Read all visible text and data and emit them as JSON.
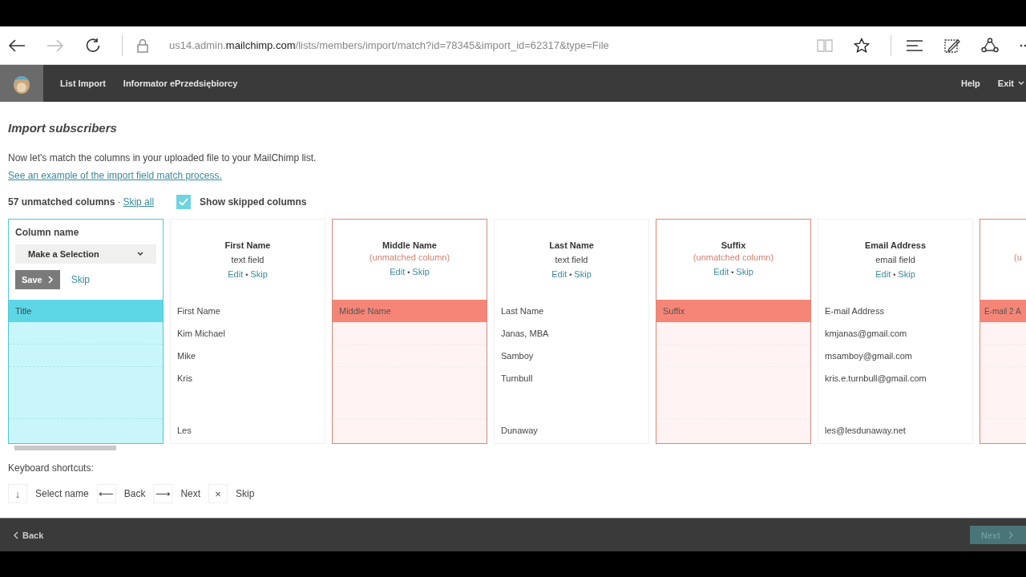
{
  "browser": {
    "url_prefix": "us14.admin.",
    "url_domain": "mailchimp.com",
    "url_path": "/lists/members/import/match?id=78345&import_id=62317&type=File"
  },
  "app_nav": {
    "items": [
      "List Import",
      "Informator ePrzedsiębiorcy"
    ],
    "help": "Help",
    "exit": "Exit"
  },
  "page": {
    "title": "Import subscribers",
    "intro": "Now let's match the columns in your uploaded file to your MailChimp list.",
    "example_link": "See an example of the import field match process.",
    "unmatched_count": "57 unmatched columns",
    "separator": "·",
    "skip_all": "Skip all",
    "show_skipped": {
      "label": "Show skipped columns",
      "checked": true
    }
  },
  "columns": [
    {
      "kind": "editing",
      "heading": "Column name",
      "select": "Make a Selection",
      "save": "Save",
      "skip": "Skip",
      "file_header": "Title"
    },
    {
      "kind": "matched",
      "name": "First Name",
      "type": "text field",
      "edit": "Edit",
      "dot": "•",
      "skip": "Skip",
      "file_header": "First Name",
      "cells": [
        "Kim Michael",
        "Mike",
        "Kris",
        "Les"
      ]
    },
    {
      "kind": "unmatched",
      "name": "Middle Name",
      "note": "(unmatched column)",
      "edit": "Edit",
      "dot": "•",
      "skip": "Skip",
      "file_header": "Middle Name"
    },
    {
      "kind": "matched",
      "name": "Last Name",
      "type": "text field",
      "edit": "Edit",
      "dot": "•",
      "skip": "Skip",
      "file_header": "Last Name",
      "cells": [
        "Janas, MBA",
        "Samboy",
        "Turnbull",
        "Dunaway"
      ]
    },
    {
      "kind": "unmatched",
      "name": "Suffix",
      "note": "(unmatched column)",
      "edit": "Edit",
      "dot": "•",
      "skip": "Skip",
      "file_header": "Suffix"
    },
    {
      "kind": "matched",
      "name": "Email Address",
      "type": "email field",
      "edit": "Edit",
      "dot": "•",
      "skip": "Skip",
      "file_header": "E-mail Address",
      "cells": [
        "kmjanas@gmail.com",
        "msamboy@gmail.com",
        "kris.e.turnbull@gmail.com",
        "les@lesdunaway.net"
      ]
    },
    {
      "kind": "partial",
      "note": "(u",
      "file_header": "E-mail 2 A"
    }
  ],
  "shortcuts": {
    "title": "Keyboard shortcuts:",
    "items": [
      {
        "key": "↓",
        "label": "Select name"
      },
      {
        "key": "⟵",
        "label": "Back"
      },
      {
        "key": "⟶",
        "label": "Next"
      },
      {
        "key": "×",
        "label": "Skip"
      }
    ]
  },
  "footer": {
    "back": "Back",
    "next": "Next",
    "next_disabled": true
  }
}
